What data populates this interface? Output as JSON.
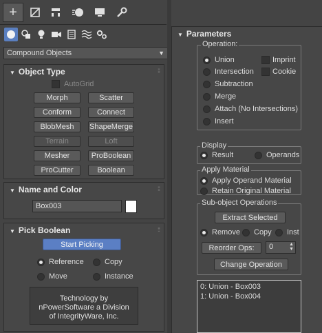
{
  "top_tabs": [
    {
      "icon": "plus-icon",
      "name": "create"
    },
    {
      "icon": "modify-icon",
      "name": "modify"
    },
    {
      "icon": "hierarchy-icon",
      "name": "hierarchy"
    },
    {
      "icon": "motion-icon",
      "name": "motion"
    },
    {
      "icon": "display-icon",
      "name": "display"
    },
    {
      "icon": "utilities-icon",
      "name": "utilities"
    }
  ],
  "sub_tabs": [
    "geometry-icon",
    "shapes-icon",
    "lights-icon",
    "cameras-icon",
    "helpers-icon",
    "spacewarps-icon",
    "systems-icon"
  ],
  "category_dropdown": {
    "value": "Compound Objects"
  },
  "object_type": {
    "title": "Object Type",
    "autogrid": "AutoGrid",
    "buttons": [
      "Morph",
      "Scatter",
      "Conform",
      "Connect",
      "BlobMesh",
      "ShapeMerge",
      "Terrain",
      "Loft",
      "Mesher",
      "ProBoolean",
      "ProCutter",
      "Boolean"
    ]
  },
  "name_color": {
    "title": "Name and Color",
    "name_value": "Box003",
    "color": "#ffffff"
  },
  "pick_boolean": {
    "title": "Pick Boolean",
    "start_picking": "Start Picking",
    "reference": "Reference",
    "copy": "Copy",
    "move": "Move",
    "instance": "Instance",
    "credit_line1": "Technology by",
    "credit_line2": "nPowerSoftware a Division",
    "credit_line3": "of IntegrityWare, Inc."
  },
  "parameters": {
    "title": "Parameters",
    "operation_label": "Operation:",
    "union": "Union",
    "intersection": "Intersection",
    "subtraction": "Subtraction",
    "merge": "Merge",
    "attach": "Attach (No Intersections)",
    "insert": "Insert",
    "imprint": "Imprint",
    "cookie": "Cookie",
    "display_label": "Display",
    "result": "Result",
    "operands": "Operands",
    "apply_material_label": "Apply Material",
    "apply_operand_material": "Apply Operand Material",
    "retain_original_material": "Retain Original Material",
    "subobject_label": "Sub-object Operations",
    "extract_selected": "Extract Selected",
    "remove": "Remove",
    "copy": "Copy",
    "inst": "Inst",
    "reorder_ops": "Reorder Ops:",
    "reorder_value": "0",
    "change_operation": "Change Operation",
    "list_items": [
      "0: Union - Box003",
      "1: Union - Box004"
    ]
  }
}
